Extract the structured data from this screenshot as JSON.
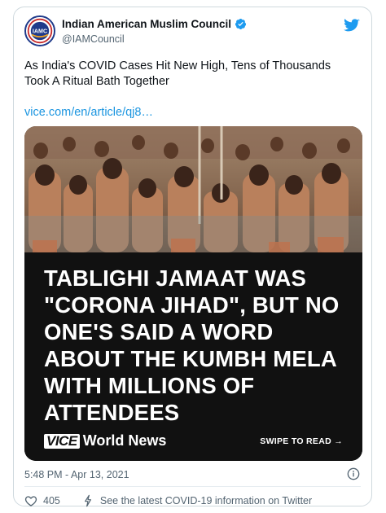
{
  "tweet": {
    "author_name": "Indian American Muslim Council",
    "author_handle": "@IAMCouncil",
    "avatar_text": "IAMC",
    "text": "As India's COVID Cases Hit New High, Tens of Thousands Took A Ritual Bath Together",
    "link": "vice.com/en/article/qj8…",
    "timestamp": "5:48 PM - Apr 13, 2021",
    "like_count": "405",
    "covid_info": "See the latest COVID-19 information on Twitter"
  },
  "media": {
    "headline": "TABLIGHI JAMAAT WAS \"CORONA JIHAD\", BUT NO ONE'S SAID A WORD ABOUT THE KUMBH MELA WITH MILLIONS OF ATTENDEES",
    "brand_logo": "VICE",
    "brand_section": "World News",
    "swipe": "SWIPE TO READ →"
  },
  "colors": {
    "twitter_blue": "#1d9bf0",
    "link_blue": "#1b95e0",
    "muted_text": "#536471",
    "panel_black": "#111111"
  },
  "icons": {
    "brand": "twitter-bird-icon",
    "verified": "verified-badge-icon",
    "info": "info-icon",
    "like": "heart-icon",
    "covid": "lightning-bolt-icon"
  }
}
